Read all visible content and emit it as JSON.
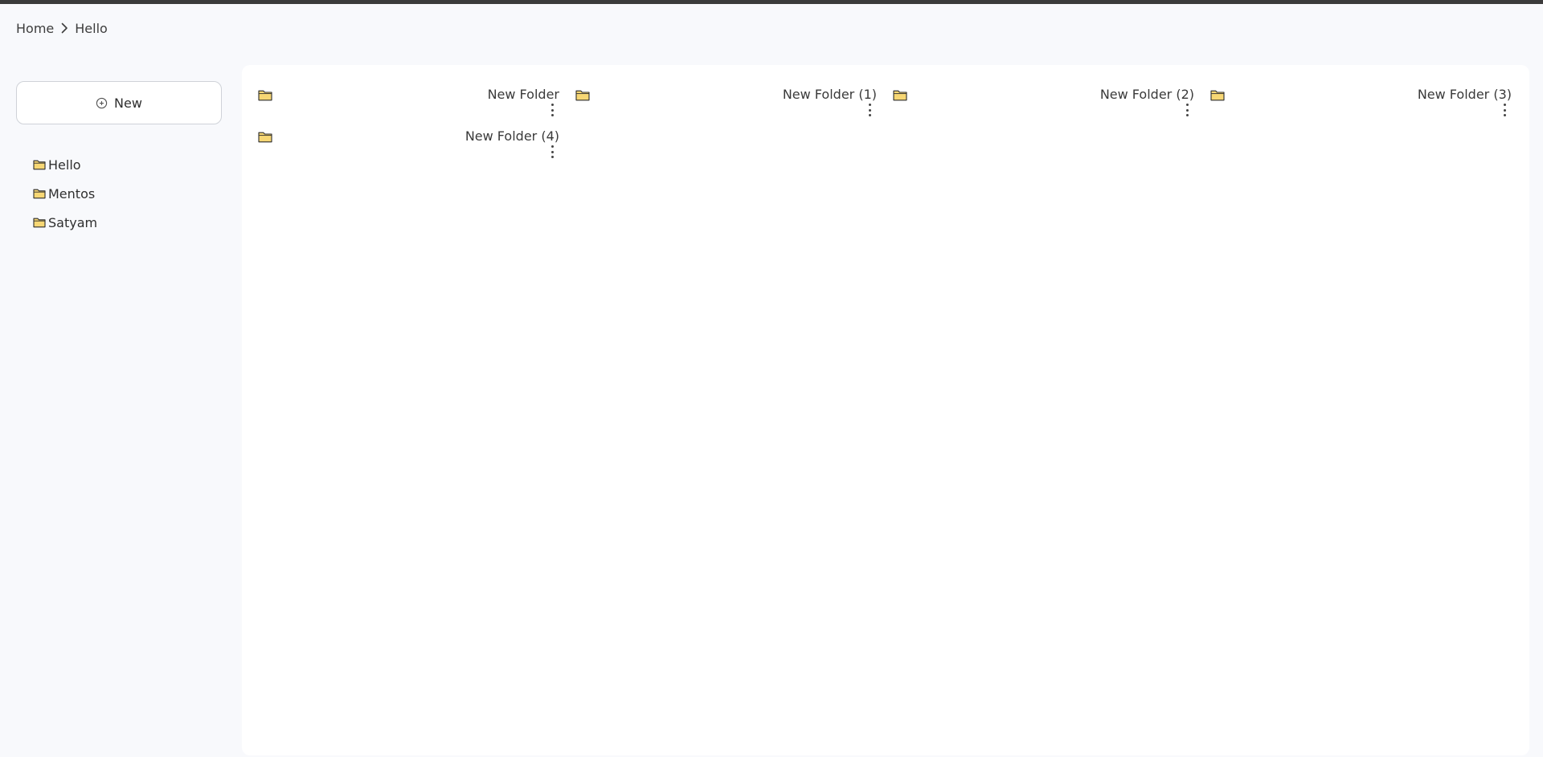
{
  "breadcrumb": {
    "items": [
      "Home",
      "Hello"
    ]
  },
  "sidebar": {
    "new_label": "New",
    "items": [
      {
        "label": "Hello",
        "icon": "folder-icon"
      },
      {
        "label": "Mentos",
        "icon": "folder-icon"
      },
      {
        "label": "Satyam",
        "icon": "folder-icon"
      }
    ]
  },
  "content": {
    "folders": [
      {
        "label": "New Folder",
        "icon": "folder-icon"
      },
      {
        "label": "New Folder (1)",
        "icon": "folder-icon"
      },
      {
        "label": "New Folder (2)",
        "icon": "folder-icon"
      },
      {
        "label": "New Folder (3)",
        "icon": "folder-icon"
      },
      {
        "label": "New Folder (4)",
        "icon": "folder-icon"
      }
    ]
  },
  "colors": {
    "folder_fill": "#f7d774",
    "folder_stroke": "#2d2d2d",
    "top_bar": "#3b3b3b",
    "page_background": "#f8f9fc",
    "panel_background": "#ffffff"
  }
}
